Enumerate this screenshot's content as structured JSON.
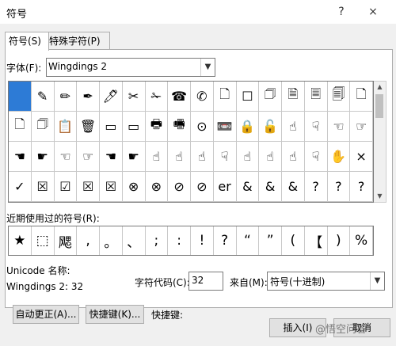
{
  "window": {
    "title": "符号",
    "help": "?",
    "close": "×"
  },
  "tabs": [
    {
      "label": "符号(S)"
    },
    {
      "label": "特殊字符(P)"
    }
  ],
  "font": {
    "label": "字体(F):",
    "value": "Wingdings 2"
  },
  "symbols": [
    "",
    "✎",
    "✏",
    "✒",
    "🖊",
    "✂",
    "✁",
    "☎",
    "✆",
    "🗋",
    "☐",
    "🗇",
    "🗎",
    "🗏",
    "🗐",
    "🗋",
    "🗋",
    "🗇",
    "📋",
    "🗑",
    "▭",
    "▭",
    "🖶",
    "🖷",
    "⊙",
    "📼",
    "🔒",
    "🔓",
    "☝",
    "☟",
    "☜",
    "☞",
    "☚",
    "☛",
    "☜",
    "☞",
    "☚",
    "☛",
    "☝",
    "☝",
    "☝",
    "☟",
    "☝",
    "☝",
    "☝",
    "☟",
    "✋",
    "×",
    "✓",
    "☒",
    "☑",
    "☒",
    "☒",
    "⊗",
    "⊗",
    "⊘",
    "⊘",
    "er",
    "&",
    "&",
    "&",
    "?",
    "?",
    "?"
  ],
  "recent": {
    "label": "近期使用过的符号(R):",
    "items": [
      "★",
      "⬚",
      "飔",
      ",",
      "。",
      "、",
      ";",
      ":",
      "!",
      "?",
      "“",
      "”",
      "(",
      "【",
      ")",
      "%"
    ]
  },
  "unicode": {
    "name_label": "Unicode 名称:",
    "value": "Wingdings 2: 32"
  },
  "code": {
    "label": "字符代码(C):",
    "value": "32"
  },
  "from": {
    "label": "来自(M):",
    "value": "符号(十进制)"
  },
  "buttons": {
    "autocorrect": "自动更正(A)...",
    "shortcut": "快捷键(K)...",
    "shortcut_label": "快捷键:",
    "insert": "插入(I)",
    "cancel": "取消"
  },
  "watermark": "@悟空问答"
}
